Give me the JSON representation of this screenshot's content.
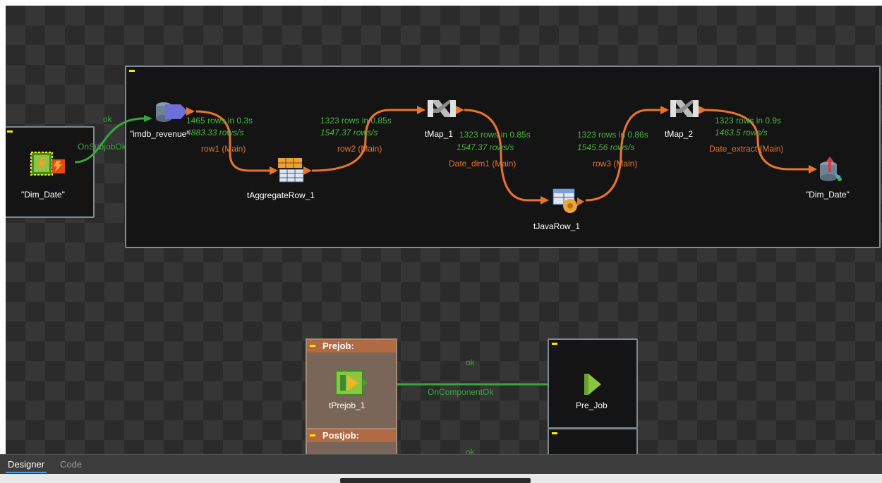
{
  "tabs": {
    "designer": "Designer",
    "code": "Code"
  },
  "components": {
    "dim_date_trigger": "\"Dim_Date\"",
    "imdb_revenue": "\"imdb_revenue\"",
    "aggregate": "tAggregateRow_1",
    "tmap1": "tMap_1",
    "javarow": "tJavaRow_1",
    "tmap2": "tMap_2",
    "dim_date_out": "\"Dim_Date\"",
    "prejob": "tPrejob_1",
    "pre_job": "Pre_Job"
  },
  "triggers": {
    "ok": "ok",
    "on_subjob_ok": "OnSubjobOk",
    "on_component_ok": "OnComponentOk",
    "ok_prejob": "ok",
    "ok_postjob": "ok"
  },
  "flows": {
    "row1": {
      "rows": "1465 rows in 0.3s",
      "rate": "4883.33 rows/s",
      "label": "row1 (Main)"
    },
    "row2": {
      "rows": "1323 rows in 0.85s",
      "rate": "1547.37 rows/s",
      "label": "row2 (Main)"
    },
    "date_dim1": {
      "rows": "1323 rows in 0.85s",
      "rate": "1547.37 rows/s",
      "label": "Date_dim1 (Main)"
    },
    "row3": {
      "rows": "1323 rows in 0.86s",
      "rate": "1545.56 rows/s",
      "label": "row3 (Main)"
    },
    "date_extract": {
      "rows": "1323 rows in 0.9s",
      "rate": "1463.5 rows/s",
      "label": "Date_extract (Main)"
    }
  },
  "headers": {
    "prejob": "Prejob:",
    "postjob": "Postjob:"
  },
  "icons": {
    "trigger": "tRunJob-trigger-icon",
    "db_input": "database-input-icon",
    "aggregate": "aggregate-icon",
    "tmap": "tmap-icon",
    "javarow": "javarow-icon",
    "db_output": "database-output-icon",
    "prejob": "prejob-icon",
    "pre_job": "play-arrow-icon"
  },
  "colors": {
    "canvas": "#2b2b2b",
    "subjob_bg": "#141414",
    "flow": "#e8742c",
    "trigger": "#3aa53a",
    "header": "#b06a44"
  }
}
